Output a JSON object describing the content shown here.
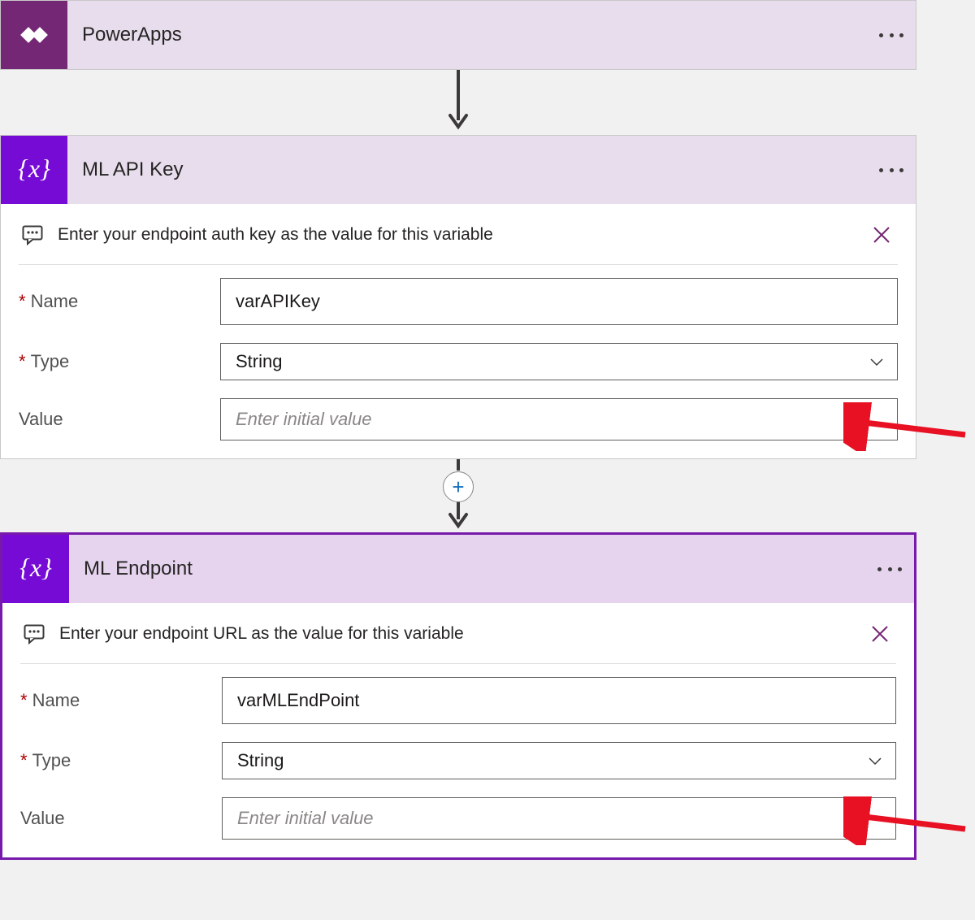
{
  "trigger": {
    "title": "PowerApps"
  },
  "action1": {
    "title": "ML API Key",
    "comment": "Enter your endpoint auth key as the value for this variable",
    "labels": {
      "name": "Name",
      "type": "Type",
      "value": "Value"
    },
    "fields": {
      "name": "varAPIKey",
      "type": "String",
      "value_placeholder": "Enter initial value"
    }
  },
  "action2": {
    "title": "ML Endpoint",
    "comment": "Enter your endpoint URL as the value for this variable",
    "labels": {
      "name": "Name",
      "type": "Type",
      "value": "Value"
    },
    "fields": {
      "name": "varMLEndPoint",
      "type": "String",
      "value_placeholder": "Enter initial value"
    }
  }
}
